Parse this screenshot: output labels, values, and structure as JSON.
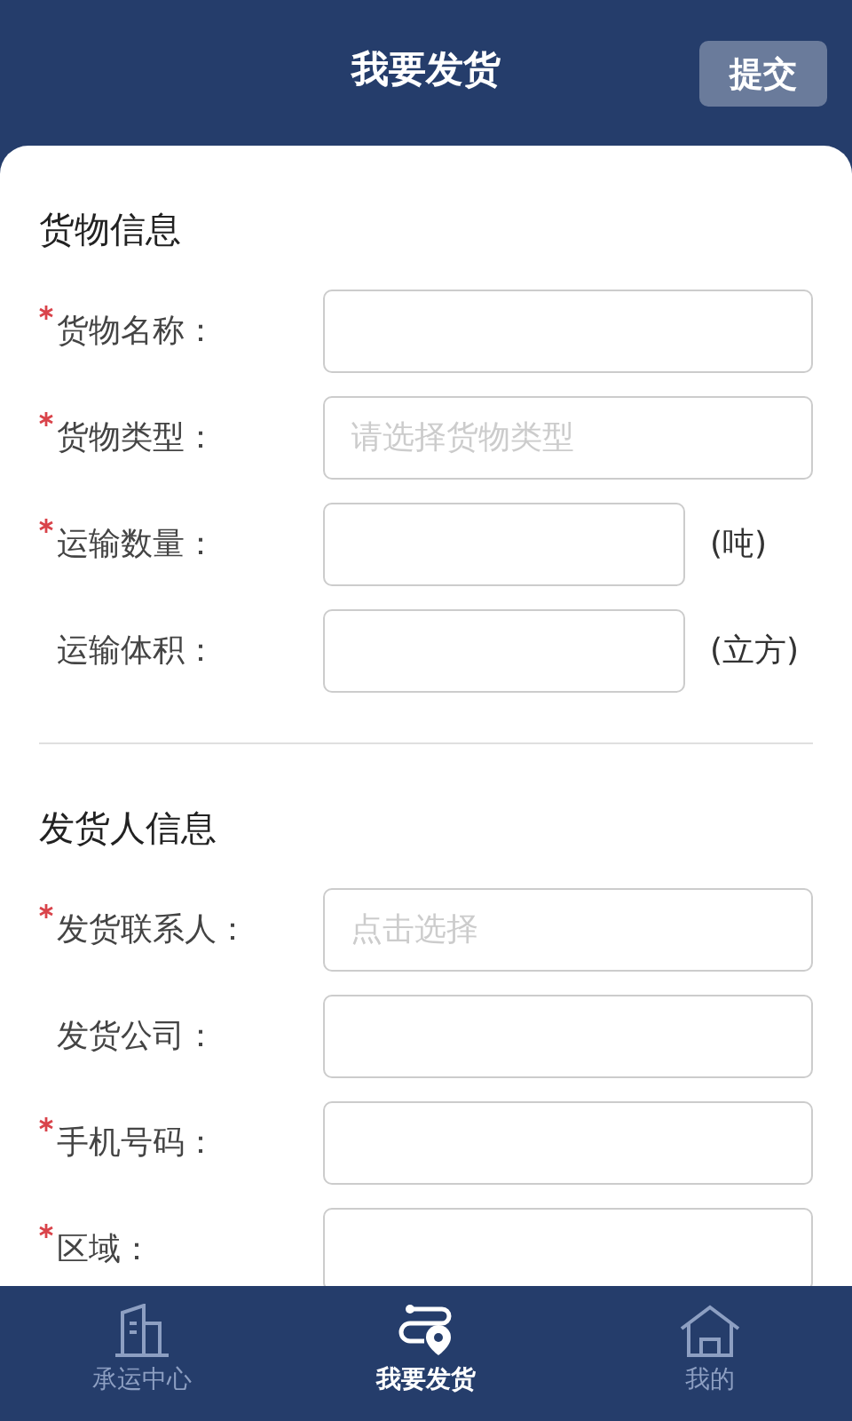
{
  "header": {
    "title": "我要发货",
    "submit_button": "提交"
  },
  "sections": [
    {
      "title": "货物信息",
      "fields": [
        {
          "label": "货物名称：",
          "required": true
        },
        {
          "label": "货物类型：",
          "required": true,
          "placeholder": "请选择货物类型"
        },
        {
          "label": "运输数量：",
          "required": true,
          "unit": "(吨)"
        },
        {
          "label": "运输体积：",
          "required": false,
          "unit": "(立方)"
        }
      ]
    },
    {
      "title": "发货人信息",
      "fields": [
        {
          "label": "发货联系人：",
          "required": true,
          "placeholder": "点击选择"
        },
        {
          "label": "发货公司：",
          "required": false
        },
        {
          "label": "手机号码：",
          "required": true
        },
        {
          "label": "区域：",
          "required": true
        }
      ]
    }
  ],
  "bottom_nav": [
    {
      "label": "承运中心",
      "selected": false
    },
    {
      "label": "我要发货",
      "selected": true
    },
    {
      "label": "我的",
      "selected": false
    }
  ]
}
